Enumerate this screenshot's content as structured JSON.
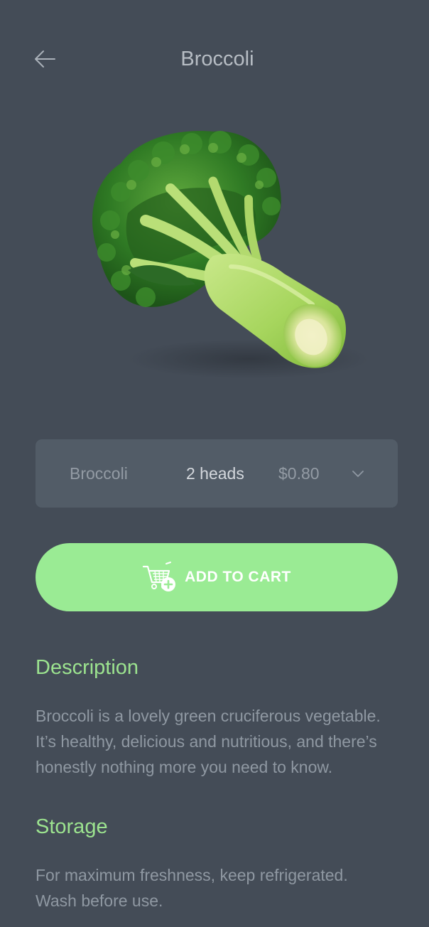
{
  "header": {
    "title": "Broccoli",
    "back_icon": "arrow-left-icon"
  },
  "product": {
    "image": "broccoli-image"
  },
  "selector": {
    "name": "Broccoli",
    "quantity": "2 heads",
    "price": "$0.80",
    "chevron_icon": "chevron-down-icon"
  },
  "cart": {
    "label": "ADD TO CART",
    "icon": "cart-plus-icon",
    "color": "#9aeb94"
  },
  "description": {
    "heading": "Description",
    "line1": "Broccoli is a lovely green cruciferous vegetable.",
    "line2": "It’s healthy, delicious and nutritious, and there’s",
    "line3": "honestly nothing more you need to know."
  },
  "storage": {
    "heading": "Storage",
    "line1": "For maximum freshness, keep refrigerated.",
    "line2": "Wash before use."
  },
  "colors": {
    "background": "#444c57",
    "accent": "#9ce38f",
    "panel": "#525c67"
  }
}
